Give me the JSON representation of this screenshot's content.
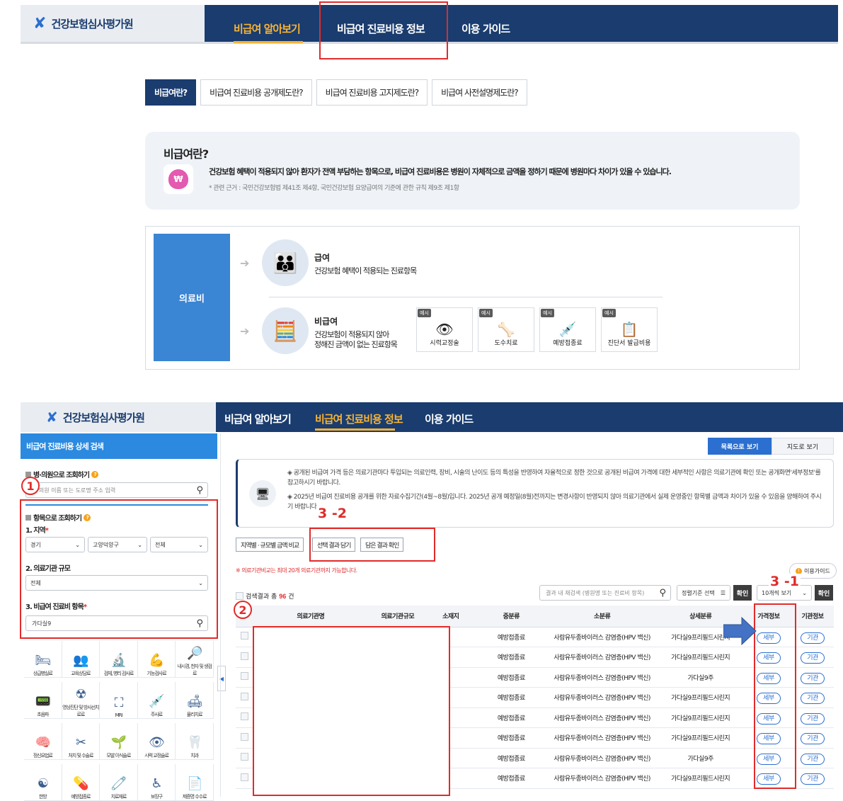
{
  "org_name": "건강보험심사평가원",
  "nav": [
    "비급여 알아보기",
    "비급여 진료비용 정보",
    "이용 가이드"
  ],
  "tabs": [
    "비급여란?",
    "비급여 진료비용 공개제도란?",
    "비급여 진료비용 고지제도란?",
    "비급여 사전설명제도란?"
  ],
  "info": {
    "title": "비급여란?",
    "desc": "건강보험 혜택이 적용되지 않아 환자가 전액 부담하는 항목으로, 비급여 진료비용은 병원이 자체적으로 금액을 정하기 때문에 병원마다 차이가 있을 수 있습니다.",
    "note": "* 관련 근거 : 국민건강보험법 제41조 제4항, 국민건강보험 요양급여의 기준에 관한 규칙 제9조 제1항"
  },
  "diagram": {
    "fee": "의료비",
    "covered_title": "급여",
    "covered_desc": "건강보험 혜택이 적용되는 진료항목",
    "non_title": "비급여",
    "non_desc1": "건강보험이 적용되지 않아",
    "non_desc2": "정해진 금액이 없는 진료항목",
    "ex_tag": "예시",
    "examples": [
      "시력교정술",
      "도수치료",
      "예방접종료",
      "진단서 발급비용"
    ]
  },
  "side": {
    "head": "비급여 진료비용 상세 검색",
    "by_hospital": "병·의원으로 조회하기",
    "hospital_placeholder": "병·의원 이름 또는 도로명 주소 입력",
    "by_item": "항목으로 조회하기",
    "region": "1. 지역",
    "region_vals": [
      "경기",
      "고양덕양구",
      "전체"
    ],
    "scale": "2. 의료기관 규모",
    "scale_val": "전체",
    "item": "3. 비급여 진료비 항목",
    "item_val": "가다실9"
  },
  "categories": [
    "상급병실료",
    "교육상담료",
    "검체, 병리 검사료",
    "기능검사료",
    "내시경, 천자 및 생검료",
    "초음파",
    "영상진단 및 방사선치료료",
    "MRI",
    "주사료",
    "물리치료",
    "정신요법료",
    "처치 및 수술료",
    "모발 이식술료",
    "시력 교정술료",
    "치과",
    "한방",
    "예방접종료",
    "치료재료",
    "보장구",
    "제증명 수수료"
  ],
  "view": {
    "list": "목록으로 보기",
    "map": "지도로 보기"
  },
  "notice1": "◈ 공개된 비급여 가격 등은 의료기관마다 투입되는 의료인력, 장비, 시술의 난이도 등의 특성을 반영하여 자율적으로 정한 것으로 공개된 비급여 가격에 대한 세부적인 사항은 의료기관에 확인 또는 공개화면'세부정보'를 참고하시기 바랍니다.",
  "notice2": "◈ 2025년 비급여 진료비용 공개를 위한 자료수집기간(4월~8월)입니다. 2025년 공개 예정일(8월)전까지는 변경사항이 반영되지 않아 의료기관에서 실제 운영중인 항목별 금액과 차이가 있을 수 있음을 양해하여 주시기 바랍니다.",
  "buttons": {
    "compare": "지역별 · 규모별 금액 비교",
    "select": "선택 결과 담기",
    "check": "담은 결과 확인",
    "guide": "이용가이드",
    "confirm": "확인",
    "confirm2": "확인"
  },
  "warn": "※ 의료기관비교는 최대 20개 의료기관까지 가능합니다.",
  "result": {
    "pre": "검색결과 총",
    "count": "96",
    "post": "건",
    "search_ph": "결과 내 재검색 (병원명 또는 진료비 항목)",
    "sort": "정렬기준 선택",
    "per": "10개씩 보기"
  },
  "headers": [
    "의료기관명",
    "의료기관규모",
    "소재지",
    "중분류",
    "소분류",
    "상세분류",
    "가격정보",
    "기관정보"
  ],
  "rows": [
    {
      "mid": "예방접종료",
      "small": "사람유두종바이러스 감염증(HPV 백신)",
      "detail": "가다실9프리필드시린지",
      "p": "세부",
      "i": "기관"
    },
    {
      "mid": "예방접종료",
      "small": "사람유두종바이러스 감염증(HPV 백신)",
      "detail": "가다실9프리필드시린지",
      "p": "세부",
      "i": "기관"
    },
    {
      "mid": "예방접종료",
      "small": "사람유두종바이러스 감염증(HPV 백신)",
      "detail": "가다실9주",
      "p": "세부",
      "i": "기관"
    },
    {
      "mid": "예방접종료",
      "small": "사람유두종바이러스 감염증(HPV 백신)",
      "detail": "가다실9프리필드시린지",
      "p": "세부",
      "i": "기관"
    },
    {
      "mid": "예방접종료",
      "small": "사람유두종바이러스 감염증(HPV 백신)",
      "detail": "가다실9프리필드시린지",
      "p": "세부",
      "i": "기관"
    },
    {
      "mid": "예방접종료",
      "small": "사람유두종바이러스 감염증(HPV 백신)",
      "detail": "가다실9프리필드시린지",
      "p": "세부",
      "i": "기관"
    },
    {
      "mid": "예방접종료",
      "small": "사람유두종바이러스 감염증(HPV 백신)",
      "detail": "가다실9주",
      "p": "세부",
      "i": "기관"
    },
    {
      "mid": "예방접종료",
      "small": "사람유두종바이러스 감염증(HPV 백신)",
      "detail": "가다실9프리필드시린지",
      "p": "세부",
      "i": "기관"
    }
  ],
  "annot": {
    "n1": "1",
    "n2": "2",
    "n32": "3 -2",
    "n31": "3 -1"
  },
  "colors": {
    "navy": "#1a3c6e",
    "accent": "#f7b335",
    "red": "#e12b2b",
    "blue": "#2b8ae0"
  }
}
